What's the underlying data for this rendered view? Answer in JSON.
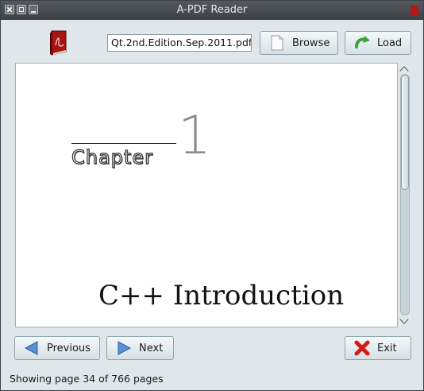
{
  "window": {
    "title": "A-PDF Reader"
  },
  "toolbar": {
    "file_value": "Qt.2nd.Edition.Sep.2011.pdf",
    "browse_label": "Browse",
    "load_label": "Load"
  },
  "document": {
    "chapter_word": "Chapter",
    "chapter_number": "1",
    "chapter_title": "C++ Introduction"
  },
  "scrollbar": {
    "position_fraction": 0.0,
    "visible_fraction": 0.48
  },
  "nav": {
    "previous_label": "Previous",
    "next_label": "Next",
    "exit_label": "Exit"
  },
  "status": {
    "text": "Showing page 34 of 766 pages"
  },
  "icons": {
    "app": "pdf-book-icon",
    "browse": "document-icon",
    "load": "refresh-arrow-icon",
    "previous": "arrow-left-icon",
    "next": "arrow-right-icon",
    "exit": "red-x-icon"
  },
  "colors": {
    "accent_green": "#3aa336",
    "nav_blue": "#5b8fd4",
    "exit_red": "#d21b1b",
    "pdf_red": "#b21818"
  }
}
